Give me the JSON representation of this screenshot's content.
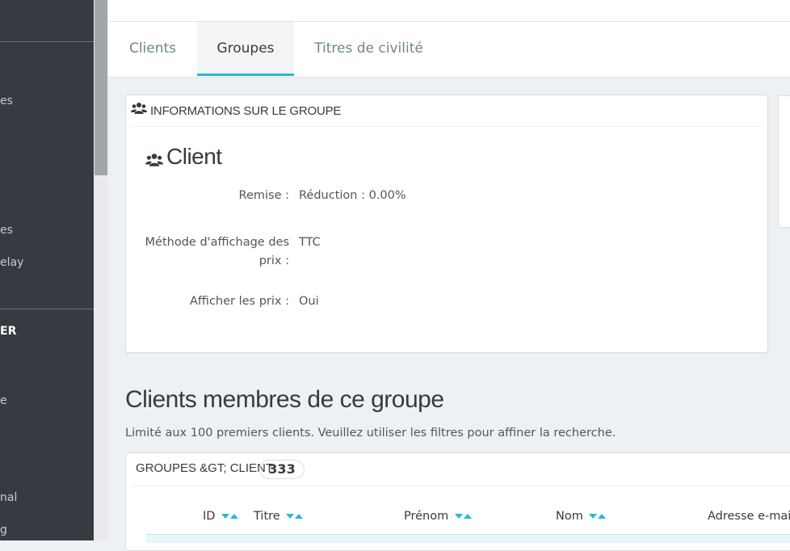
{
  "sidebar": {
    "items": [
      {
        "label": "es"
      },
      {
        "label": "es"
      },
      {
        "label": "elay"
      },
      {
        "label": "ER"
      },
      {
        "label": "e"
      },
      {
        "label": "nal"
      },
      {
        "label": "g"
      }
    ]
  },
  "tabs": [
    {
      "label": "Clients",
      "active": false
    },
    {
      "label": "Groupes",
      "active": true
    },
    {
      "label": "Titres de civilité",
      "active": false
    }
  ],
  "group_info": {
    "heading": "INFORMATIONS SUR LE GROUPE",
    "icon": "users-icon",
    "name": "Client",
    "fields": [
      {
        "label": "Remise :",
        "value": "Réduction : 0.00%"
      },
      {
        "label": "Méthode d'affichage des prix :",
        "value": "TTC"
      },
      {
        "label": "Afficher les prix :",
        "value": "Oui"
      }
    ]
  },
  "members": {
    "title": "Clients membres de ce groupe",
    "help": "Limité aux 100 premiers clients. Veuillez utiliser les filtres pour affiner la recherche.",
    "list_heading": "GROUPES &GT; CLIENT",
    "count": "333",
    "columns": [
      {
        "label": "ID"
      },
      {
        "label": "Titre"
      },
      {
        "label": "Prénom"
      },
      {
        "label": "Nom"
      },
      {
        "label": "Adresse e-mail"
      }
    ]
  },
  "colors": {
    "accent": "#25b9d7",
    "sidebar_bg": "#363a41"
  }
}
